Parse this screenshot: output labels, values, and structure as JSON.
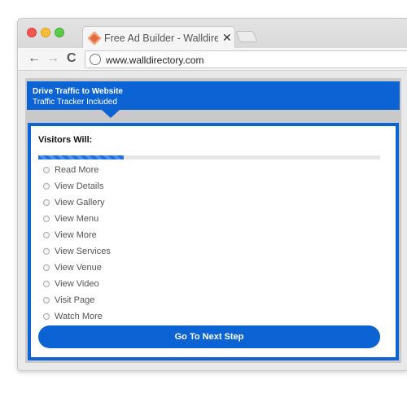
{
  "browser": {
    "tab_title": "Free Ad Builder - Walldirectory",
    "url": "www.walldirectory.com",
    "icons": {
      "back": "arrow-left-icon",
      "forward": "arrow-right-icon",
      "reload": "reload-icon",
      "site": "globe-icon",
      "tab_close": "close-icon"
    },
    "glyphs": {
      "back": "←",
      "forward": "→",
      "reload": "C",
      "close": "✕"
    }
  },
  "header": {
    "title": "Drive Traffic to Website",
    "subtitle": "Traffic Tracker Included"
  },
  "form": {
    "title": "Visitors Will:",
    "progress_percent": 25,
    "options": [
      "Read More",
      "View Details",
      "View Gallery",
      "View Menu",
      "View More",
      "View Services",
      "View Venue",
      "View Video",
      "Visit Page",
      "Watch More"
    ],
    "selected_option": null,
    "next_button": "Go To Next Step"
  },
  "colors": {
    "accent": "#0c63d3",
    "progress": "#1b6fe0"
  }
}
